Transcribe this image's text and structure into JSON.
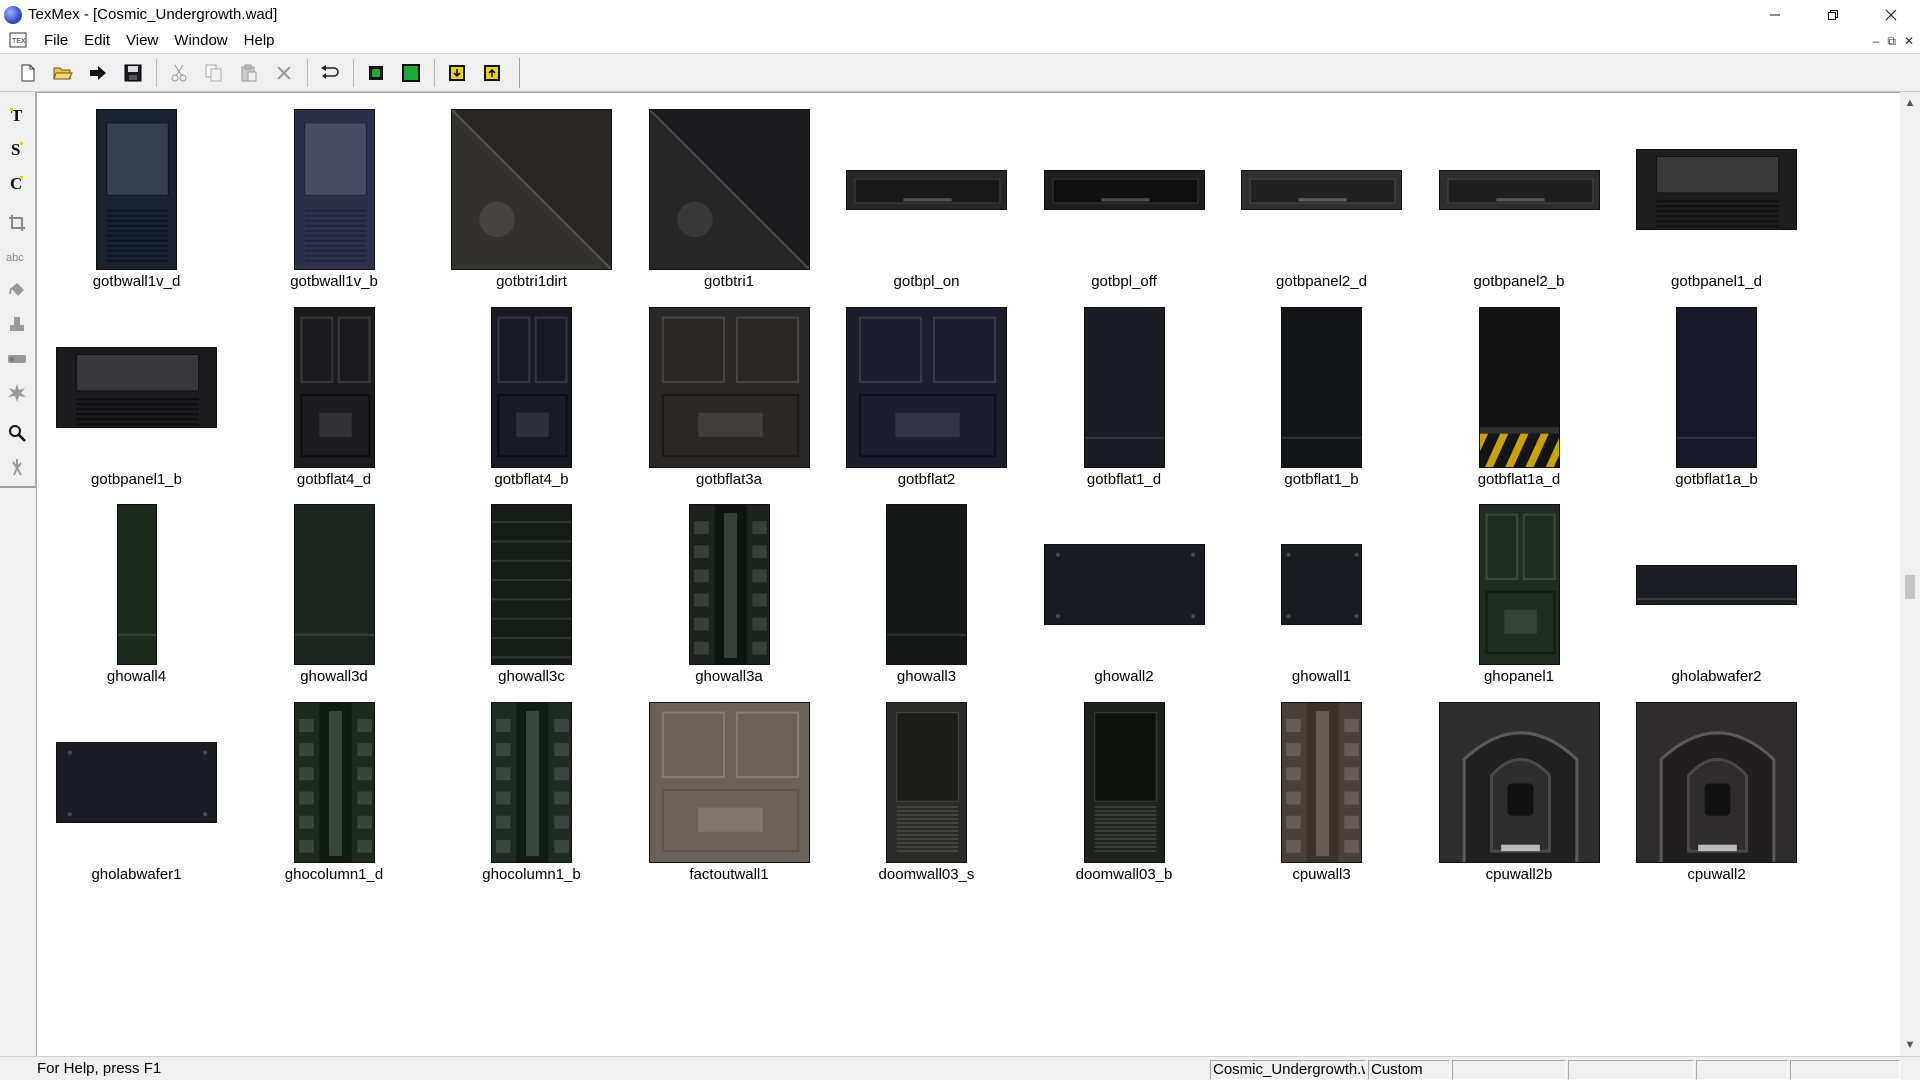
{
  "window": {
    "title": "TexMex - [Cosmic_Undergrowth.wad]",
    "minimize_icon": "minimize-icon",
    "maximize_icon": "restore-icon",
    "close_icon": "close-icon"
  },
  "menubar": {
    "items": [
      "File",
      "Edit",
      "View",
      "Window",
      "Help"
    ]
  },
  "toolbar": {
    "buttons": [
      "new-icon",
      "open-icon",
      "arrow-right-icon",
      "save-icon",
      "cut-icon",
      "copy-icon",
      "paste-icon",
      "delete-icon",
      "undo-icon",
      "fit-green-icon",
      "fit-green-large-icon",
      "import-icon",
      "export-icon"
    ]
  },
  "left_tools": {
    "buttons": [
      "text-tool-icon",
      "s-tool-icon",
      "rotate-tool-icon",
      "crop-tool-icon",
      "abc-tool-icon",
      "bucket-tool-icon",
      "stamp-tool-icon",
      "brush-tool-icon",
      "burst-tool-icon",
      "zoom-tool-icon",
      "hand-tool-icon"
    ]
  },
  "textures": [
    {
      "name": "gotbwall1v_d",
      "w": 64,
      "h": 128,
      "base": "#1b2230",
      "pat": "vent"
    },
    {
      "name": "gotbwall1v_b",
      "w": 64,
      "h": 128,
      "base": "#2c3148",
      "pat": "vent"
    },
    {
      "name": "gotbtri1dirt",
      "w": 128,
      "h": 128,
      "base": "#2a2826",
      "pat": "tri"
    },
    {
      "name": "gotbtri1",
      "w": 128,
      "h": 128,
      "base": "#1c1c1e",
      "pat": "tri"
    },
    {
      "name": "gotbpl_on",
      "w": 128,
      "h": 32,
      "base": "#262626",
      "pat": "strip"
    },
    {
      "name": "gotbpl_off",
      "w": 128,
      "h": 32,
      "base": "#1e1e1e",
      "pat": "strip"
    },
    {
      "name": "gotbpanel2_d",
      "w": 128,
      "h": 32,
      "base": "#2f2f2f",
      "pat": "strip"
    },
    {
      "name": "gotbpanel2_b",
      "w": 128,
      "h": 32,
      "base": "#2c2c2c",
      "pat": "strip"
    },
    {
      "name": "gotbpanel1_d",
      "w": 128,
      "h": 64,
      "base": "#1e1e1e",
      "pat": "vent"
    },
    {
      "name": "gotbpanel1_b",
      "w": 128,
      "h": 64,
      "base": "#1c1c20",
      "pat": "vent"
    },
    {
      "name": "gotbflat4_d",
      "w": 64,
      "h": 128,
      "base": "#1c1c1e",
      "pat": "panel"
    },
    {
      "name": "gotbflat4_b",
      "w": 64,
      "h": 128,
      "base": "#1a1a24",
      "pat": "panel"
    },
    {
      "name": "gotbflat3a",
      "w": 128,
      "h": 128,
      "base": "#2a2826",
      "pat": "panel"
    },
    {
      "name": "gotbflat2",
      "w": 128,
      "h": 128,
      "base": "#1c1e2c",
      "pat": "panel"
    },
    {
      "name": "gotbflat1_d",
      "w": 64,
      "h": 128,
      "base": "#1a1c26",
      "pat": "plain"
    },
    {
      "name": "gotbflat1_b",
      "w": 64,
      "h": 128,
      "base": "#141518",
      "pat": "plain"
    },
    {
      "name": "gotbflat1a_d",
      "w": 64,
      "h": 128,
      "base": "#141414",
      "pat": "hazard"
    },
    {
      "name": "gotbflat1a_b",
      "w": 64,
      "h": 128,
      "base": "#171a26",
      "pat": "plain"
    },
    {
      "name": "ghowall4",
      "w": 32,
      "h": 128,
      "base": "#1c2a1e",
      "pat": "plain"
    },
    {
      "name": "ghowall3d",
      "w": 64,
      "h": 128,
      "base": "#1c261e",
      "pat": "plain"
    },
    {
      "name": "ghowall3c",
      "w": 64,
      "h": 128,
      "base": "#161c18",
      "pat": "lines"
    },
    {
      "name": "ghowall3a",
      "w": 64,
      "h": 128,
      "base": "#1c231e",
      "pat": "column"
    },
    {
      "name": "ghowall3",
      "w": 64,
      "h": 128,
      "base": "#141817",
      "pat": "plain"
    },
    {
      "name": "ghowall2",
      "w": 128,
      "h": 64,
      "base": "#1a1c24",
      "pat": "rivet"
    },
    {
      "name": "ghowall1",
      "w": 64,
      "h": 64,
      "base": "#1a1c22",
      "pat": "rivet"
    },
    {
      "name": "ghopanel1",
      "w": 64,
      "h": 128,
      "base": "#1e2c22",
      "pat": "panel"
    },
    {
      "name": "gholabwafer2",
      "w": 128,
      "h": 32,
      "base": "#1c1e26",
      "pat": "plain"
    },
    {
      "name": "gholabwafer1",
      "w": 128,
      "h": 64,
      "base": "#1a1c26",
      "pat": "rivet"
    },
    {
      "name": "ghocolumn1_d",
      "w": 64,
      "h": 128,
      "base": "#1e2a1e",
      "pat": "column"
    },
    {
      "name": "ghocolumn1_b",
      "w": 64,
      "h": 128,
      "base": "#1e2a22",
      "pat": "column"
    },
    {
      "name": "factoutwall1",
      "w": 128,
      "h": 128,
      "base": "#6a625a",
      "pat": "panel"
    },
    {
      "name": "doomwall03_s",
      "w": 64,
      "h": 128,
      "base": "#2a2a28",
      "pat": "door"
    },
    {
      "name": "doomwall03_b",
      "w": 64,
      "h": 128,
      "base": "#1e221e",
      "pat": "door"
    },
    {
      "name": "cpuwall3",
      "w": 64,
      "h": 128,
      "base": "#4a4038",
      "pat": "column"
    },
    {
      "name": "cpuwall2b",
      "w": 128,
      "h": 128,
      "base": "#2e2e2e",
      "pat": "arch"
    },
    {
      "name": "cpuwall2",
      "w": 128,
      "h": 128,
      "base": "#2e2c2c",
      "pat": "arch"
    }
  ],
  "status": {
    "help": "For Help, press F1",
    "wad_name": "Cosmic_Undergrowth.wad",
    "palette": "Custom",
    "pane3": "",
    "pane4": "",
    "pane5": "",
    "pane6": ""
  }
}
